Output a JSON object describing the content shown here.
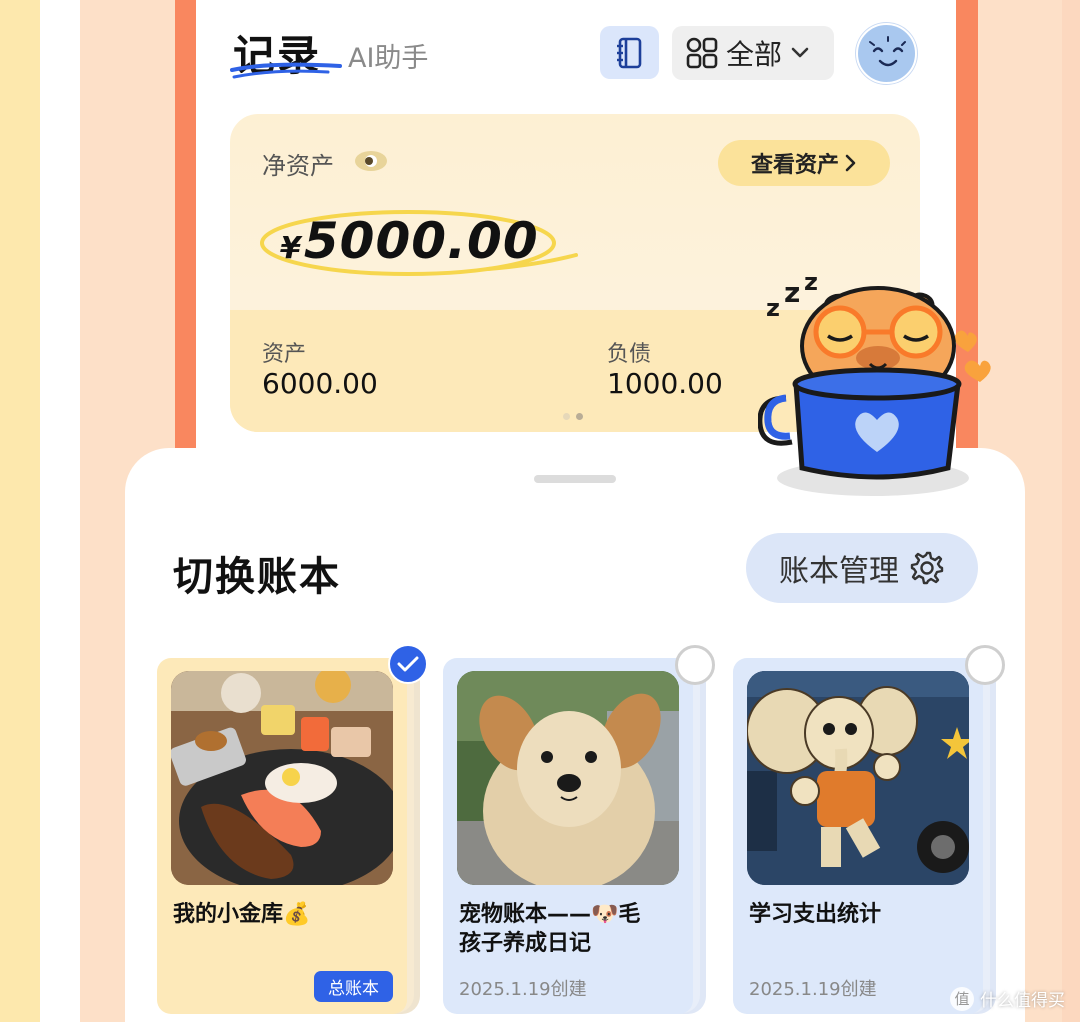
{
  "header": {
    "title": "记录",
    "subtitle": "AI助手",
    "filter_label": "全部"
  },
  "asset_card": {
    "net_label": "净资产",
    "view_button_label": "查看资产",
    "currency": "¥",
    "net_amount": "5000.00",
    "assets_label": "资产",
    "assets_value": "6000.00",
    "liabilities_label": "负债",
    "liabilities_value": "1000.00",
    "page_count": 2,
    "active_page": 2
  },
  "sheet": {
    "title": "切换账本",
    "manage_label": "账本管理"
  },
  "books": [
    {
      "name": "我的小金库💰",
      "badge": "总账本",
      "selected": true
    },
    {
      "name_line1": "宠物账本——🐶毛",
      "name_line2": "孩子养成日记",
      "date": "2025.1.19创建",
      "selected": false
    },
    {
      "name": "学习支出统计",
      "date": "2025.1.19创建",
      "selected": false
    }
  ],
  "watermark": "什么值得买",
  "colors": {
    "accent_blue": "#2f62e6",
    "frame_orange": "#f9875f",
    "card_yellow": "#fde9b9",
    "book_blue": "#dde8fa"
  }
}
